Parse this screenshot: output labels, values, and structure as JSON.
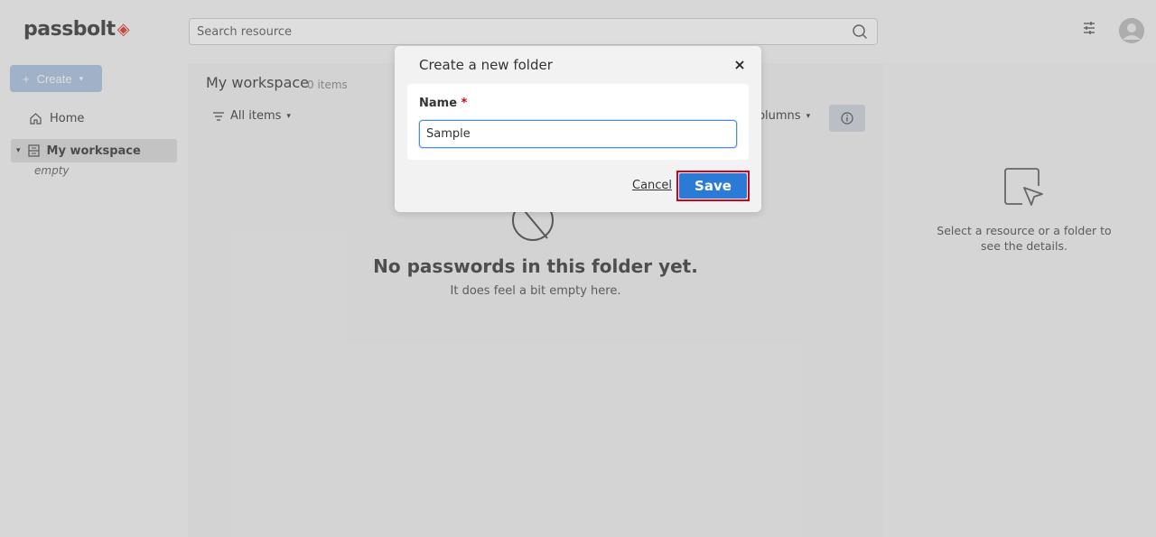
{
  "brand": {
    "logo_text": "passbolt",
    "accent": "#e2564c"
  },
  "search": {
    "placeholder": "Search resource"
  },
  "sidebar": {
    "create_label": "Create",
    "items": [
      {
        "label": "Home",
        "icon": "home-icon"
      },
      {
        "label": "My workspace",
        "icon": "workspace-icon",
        "sub": "empty"
      }
    ]
  },
  "main": {
    "title": "My workspace",
    "count": "0 items",
    "filter_label": "All items",
    "columns_label": "Columns",
    "empty_title": "No passwords in this folder yet.",
    "empty_subtitle": "It does feel a bit empty here."
  },
  "details": {
    "message": "Select a resource or a folder to see the details."
  },
  "dialog": {
    "title": "Create a new folder",
    "name_label": "Name",
    "required_mark": "*",
    "name_value": "Sample",
    "cancel_label": "Cancel",
    "save_label": "Save"
  },
  "colors": {
    "primary_button": "#2b7bd6",
    "highlight_border": "#d0021b"
  }
}
